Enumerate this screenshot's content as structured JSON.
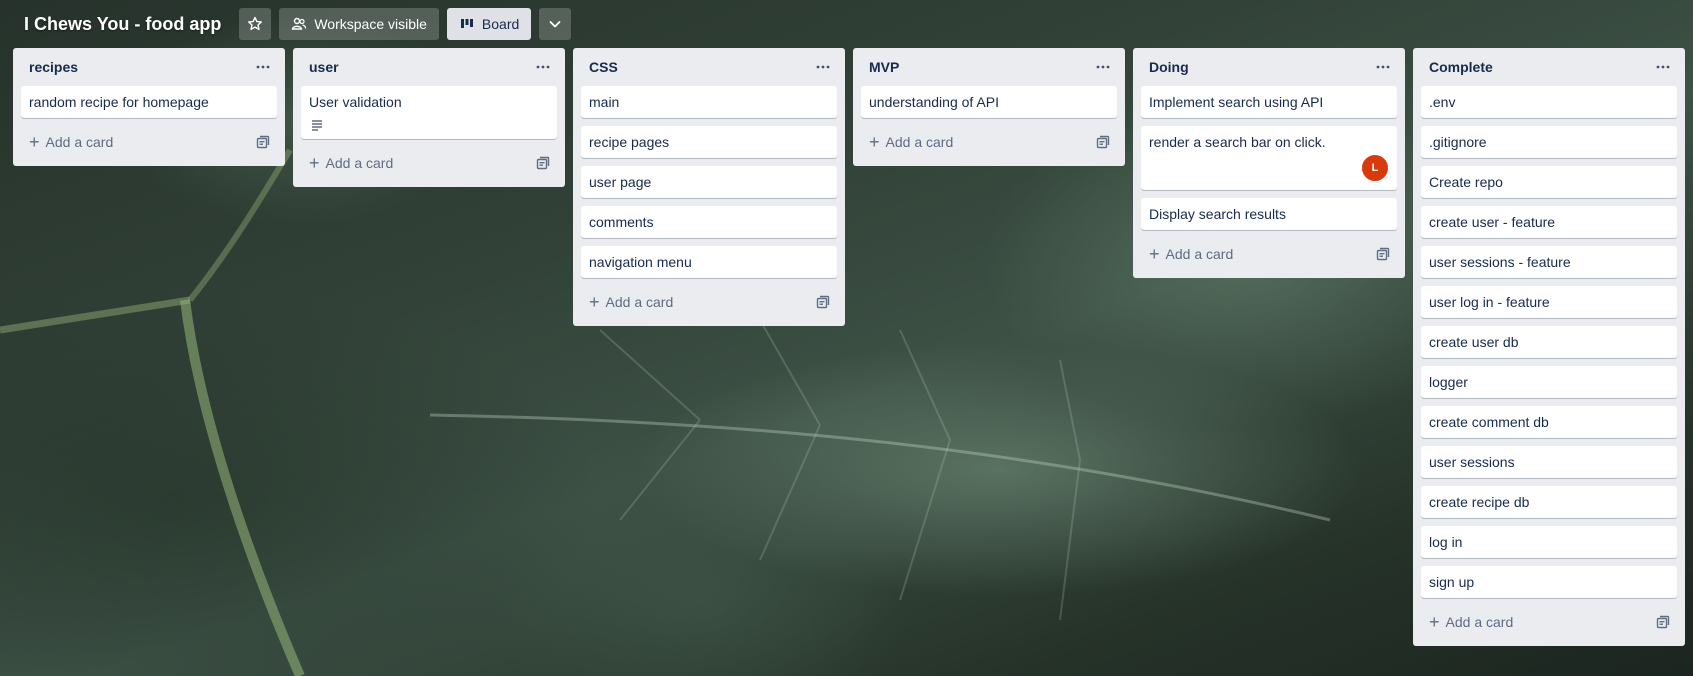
{
  "header": {
    "title": "I Chews You - food app",
    "star_icon": "star-icon",
    "visibility_label": "Workspace visible",
    "visibility_icon": "people-icon",
    "view_label": "Board",
    "view_icon": "board-icon",
    "view_switch_icon": "chevron-down-icon"
  },
  "add_card_label": "Add a card",
  "colors": {
    "list_bg": "#ebecf0",
    "card_bg": "#ffffff",
    "avatar": "#d93a0b",
    "text": "#172b4d"
  },
  "lists": [
    {
      "title": "recipes",
      "cards": [
        {
          "title": "random recipe for homepage"
        }
      ]
    },
    {
      "title": "user",
      "cards": [
        {
          "title": "User validation",
          "has_description": true
        }
      ]
    },
    {
      "title": "CSS",
      "cards": [
        {
          "title": "main"
        },
        {
          "title": "recipe pages"
        },
        {
          "title": "user page"
        },
        {
          "title": "comments"
        },
        {
          "title": "navigation menu"
        }
      ]
    },
    {
      "title": "MVP",
      "cards": [
        {
          "title": "understanding of API"
        }
      ]
    },
    {
      "title": "Doing",
      "cards": [
        {
          "title": "Implement search using API"
        },
        {
          "title": "render a search bar on click.",
          "member": "L"
        },
        {
          "title": "Display search results"
        }
      ]
    },
    {
      "title": "Complete",
      "cards": [
        {
          "title": ".env"
        },
        {
          "title": ".gitignore"
        },
        {
          "title": "Create repo"
        },
        {
          "title": "create user - feature"
        },
        {
          "title": "user sessions - feature"
        },
        {
          "title": "user log in - feature"
        },
        {
          "title": "create user db"
        },
        {
          "title": "logger"
        },
        {
          "title": "create comment db"
        },
        {
          "title": "user sessions"
        },
        {
          "title": "create recipe db"
        },
        {
          "title": "log in"
        },
        {
          "title": "sign up"
        }
      ]
    }
  ]
}
